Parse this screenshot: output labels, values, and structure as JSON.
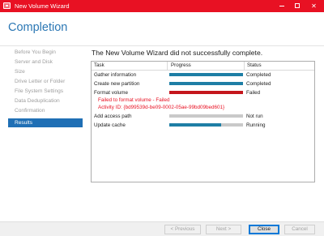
{
  "window": {
    "title": "New Volume Wizard",
    "accent": "#e81123"
  },
  "page": {
    "title": "Completion",
    "title_color": "#2b77b4"
  },
  "nav": {
    "items": [
      {
        "label": "Before You Begin",
        "active": false
      },
      {
        "label": "Server and Disk",
        "active": false
      },
      {
        "label": "Size",
        "active": false
      },
      {
        "label": "Drive Letter or Folder",
        "active": false
      },
      {
        "label": "File System Settings",
        "active": false
      },
      {
        "label": "Data Deduplication",
        "active": false
      },
      {
        "label": "Confirmation",
        "active": false
      },
      {
        "label": "Results",
        "active": true
      }
    ]
  },
  "main": {
    "headline": "The New Volume Wizard did not successfully complete.",
    "columns": {
      "task": "Task",
      "progress": "Progress",
      "status": "Status"
    },
    "tasks": [
      {
        "task": "Gather information",
        "progress": 1.0,
        "status": "Completed",
        "bar_color": "#1e7ea5"
      },
      {
        "task": "Create new partition",
        "progress": 1.0,
        "status": "Completed",
        "bar_color": "#1e7ea5"
      },
      {
        "task": "Format volume",
        "progress": 1.0,
        "status": "Failed",
        "bar_color": "#c4161c"
      },
      {
        "task": "Add access path",
        "progress": 0.0,
        "status": "Not run",
        "bar_color": "#1e7ea5"
      },
      {
        "task": "Update cache",
        "progress": 0.7,
        "status": "Running",
        "bar_color": "#1e7ea5"
      }
    ],
    "error": {
      "line1": "Failed to format volume - Failed",
      "line2": "Activity ID: {bd99539d-be09-0002-05ae-99bd09bed601}"
    }
  },
  "buttons": {
    "previous": "< Previous",
    "next": "Next >",
    "close": "Close",
    "cancel": "Cancel"
  }
}
